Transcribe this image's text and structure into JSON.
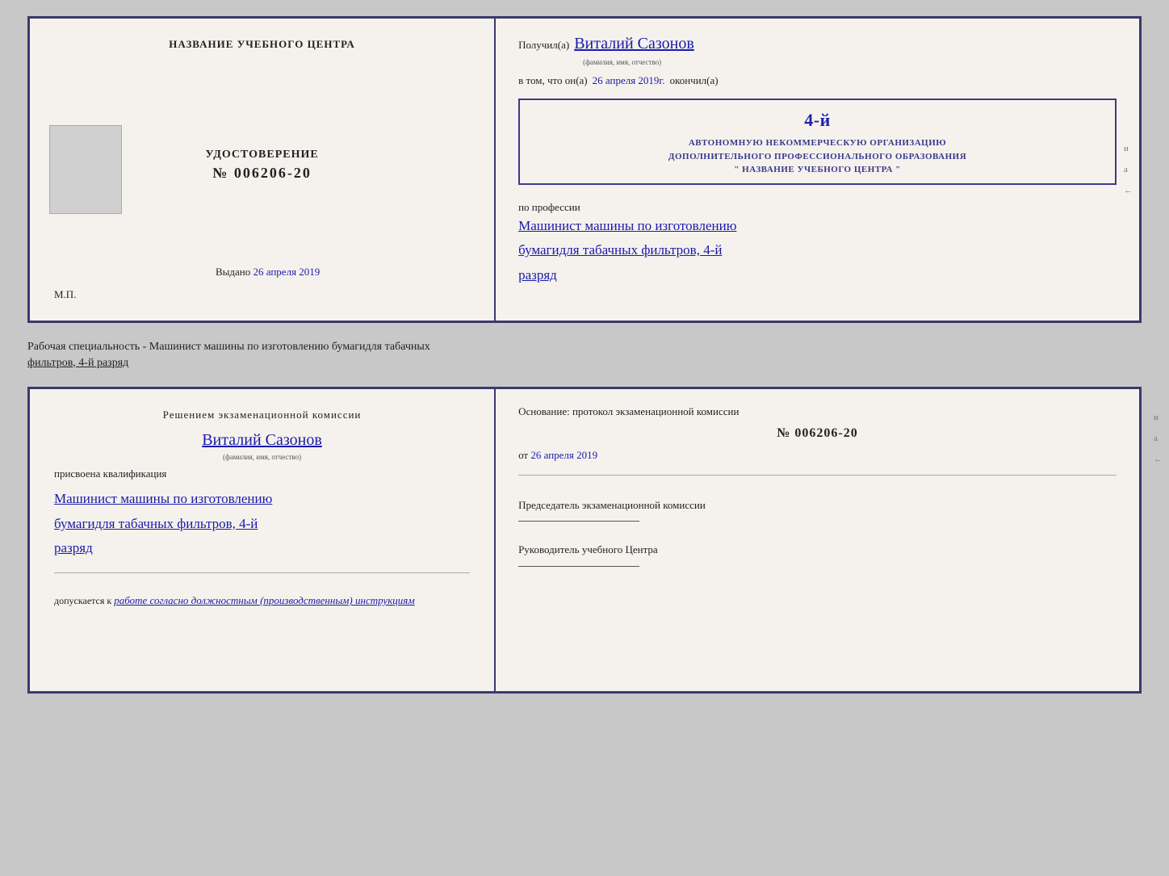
{
  "top_document": {
    "left": {
      "center_title": "НАЗВАНИЕ УЧЕБНОГО ЦЕНТРА",
      "udostoverenie_label": "УДОСТОВЕРЕНИЕ",
      "udostoverenie_number": "№ 006206-20",
      "vydano_label": "Выдано",
      "vydano_date": "26 апреля 2019",
      "mp_label": "М.П."
    },
    "right": {
      "poluchil_prefix": "Получил(а)",
      "recipient_name": "Виталий Сазонов",
      "fio_label": "(фамилия, имя, отчество)",
      "v_tom_prefix": "в том, что он(а)",
      "completion_date": "26 апреля 2019г.",
      "okonchil_label": "окончил(а)",
      "stamp_line1": "АВТОНОМНУЮ НЕКОММЕРЧЕСКУЮ ОРГАНИЗАЦИЮ",
      "stamp_line2": "ДОПОЛНИТЕЛЬНОГО ПРОФЕССИОНАЛЬНОГО ОБРАЗОВАНИЯ",
      "stamp_line3": "\" НАЗВАНИЕ УЧЕБНОГО ЦЕНТРА \"",
      "stamp_number": "4-й",
      "po_professii_label": "по профессии",
      "profession_line1": "Машинист машины по изготовлению",
      "profession_line2": "бумагидля табачных фильтров, 4-й",
      "profession_line3": "разряд"
    }
  },
  "separator": {
    "text": "Рабочая специальность - Машинист машины по изготовлению бумагидля табачных",
    "text2": "фильтров, 4-й разряд"
  },
  "bottom_document": {
    "left": {
      "decision_title": "Решением  экзаменационной  комиссии",
      "name": "Виталий Сазонов",
      "fio_label": "(фамилия, имя, отчество)",
      "prisvoena_label": "присвоена квалификация",
      "qualification_line1": "Машинист машины по изготовлению",
      "qualification_line2": "бумагидля табачных фильтров, 4-й",
      "qualification_line3": "разряд",
      "dopuskaetsya_label": "допускается к",
      "dopuskaetsya_value": "работе согласно должностным (производственным) инструкциям"
    },
    "right": {
      "osnovanie_label": "Основание:  протокол  экзаменационной  комиссии",
      "protocol_number": "№  006206-20",
      "ot_prefix": "от",
      "ot_date": "26 апреля 2019",
      "predsedatel_label": "Председатель экзаменационной комиссии",
      "rukovoditel_label": "Руководитель учебного Центра"
    }
  },
  "side_marks": {
    "mark1": "и",
    "mark2": "а",
    "mark3": "←"
  }
}
